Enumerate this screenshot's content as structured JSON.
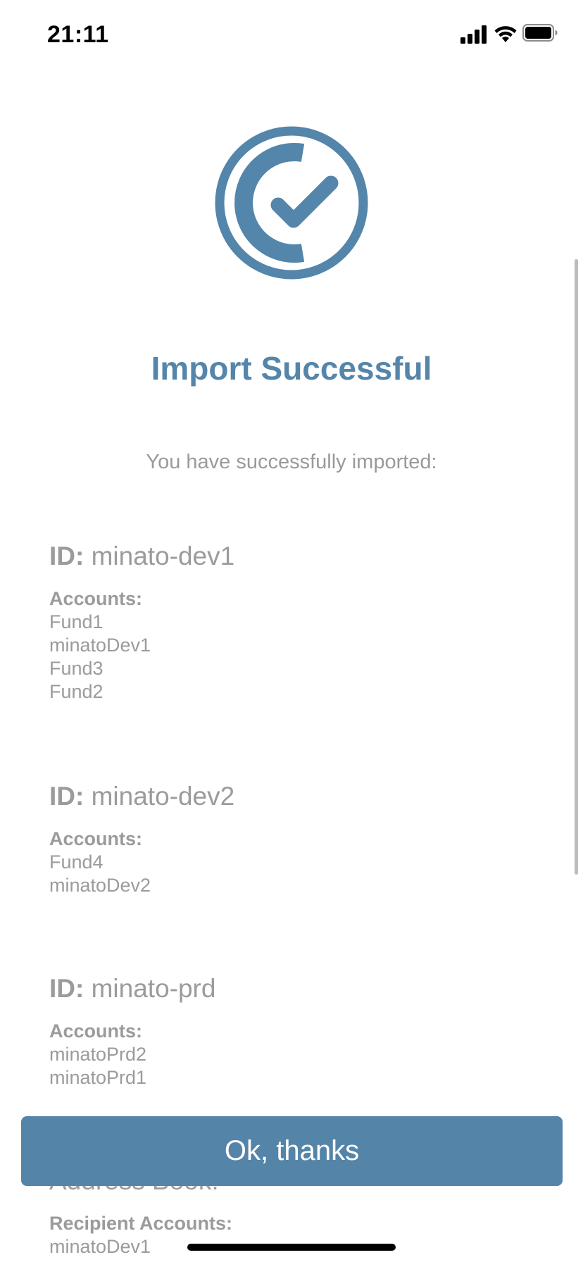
{
  "status_bar": {
    "time": "21:11"
  },
  "icons": {
    "success": "circle-check-icon",
    "signal": "cellular-signal-icon",
    "wifi": "wifi-icon",
    "battery": "battery-icon"
  },
  "colors": {
    "accent": "#5485aa",
    "text_muted": "#9b9b9b",
    "button_bg": "#5584a9",
    "button_text": "#ffffff"
  },
  "title": "Import Successful",
  "subtitle": "You have successfully imported:",
  "entries": [
    {
      "id_label": "ID:",
      "id_value": " minato-dev1",
      "accounts_label": "Accounts:",
      "accounts": [
        "Fund1",
        "minatoDev1",
        "Fund3",
        "Fund2"
      ]
    },
    {
      "id_label": "ID:",
      "id_value": " minato-dev2",
      "accounts_label": "Accounts:",
      "accounts": [
        "Fund4",
        "minatoDev2"
      ]
    },
    {
      "id_label": "ID:",
      "id_value": " minato-prd",
      "accounts_label": "Accounts:",
      "accounts": [
        "minatoPrd2",
        "minatoPrd1"
      ]
    }
  ],
  "address_book": {
    "heading": "Address Book:",
    "recipients_label": "Recipient Accounts:",
    "recipients": [
      "minatoDev1"
    ]
  },
  "ok_button": {
    "label": "Ok, thanks"
  }
}
